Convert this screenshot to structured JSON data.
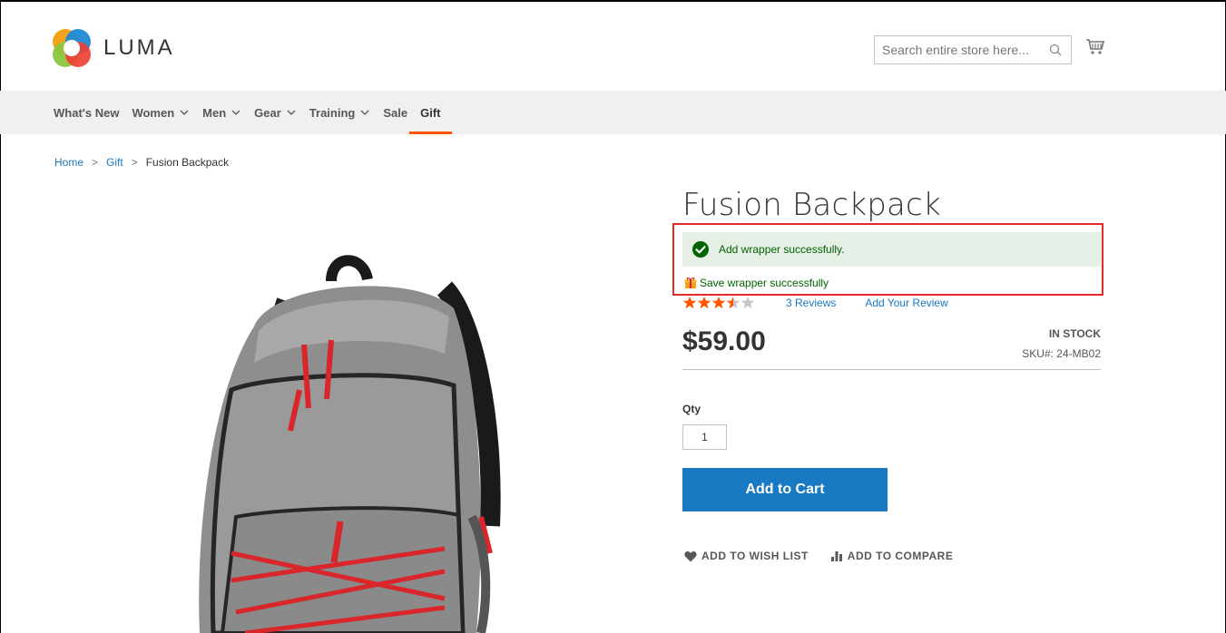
{
  "header": {
    "brand": "LUMA",
    "search_placeholder": "Search entire store here..."
  },
  "nav": {
    "items": [
      {
        "label": "What's New",
        "has_dropdown": false
      },
      {
        "label": "Women",
        "has_dropdown": true
      },
      {
        "label": "Men",
        "has_dropdown": true
      },
      {
        "label": "Gear",
        "has_dropdown": true
      },
      {
        "label": "Training",
        "has_dropdown": true
      },
      {
        "label": "Sale",
        "has_dropdown": false
      },
      {
        "label": "Gift",
        "has_dropdown": false,
        "active": true
      }
    ]
  },
  "breadcrumb": {
    "home": "Home",
    "category": "Gift",
    "current": "Fusion Backpack",
    "separator": ">"
  },
  "product": {
    "title": "Fusion Backpack",
    "success_message": "Add wrapper successfully.",
    "gift_note": "Save wrapper successfully",
    "rating_stars": 3.5,
    "rating_max": 5,
    "reviews_label": "3  Reviews",
    "add_review_label": "Add Your Review",
    "price": "$59.00",
    "stock": "IN STOCK",
    "sku_label": "SKU#:",
    "sku": "24-MB02",
    "qty_label": "Qty",
    "qty_value": "1",
    "add_to_cart_label": "Add to Cart",
    "wishlist_label": "ADD TO WISH LIST",
    "compare_label": "ADD TO COMPARE"
  },
  "colors": {
    "accent_orange": "#ff5501",
    "link_blue": "#1979c3",
    "success_green": "#006400",
    "success_bg": "#e5efe5",
    "highlight_red": "#e02b27",
    "star_orange": "#ff5501"
  }
}
